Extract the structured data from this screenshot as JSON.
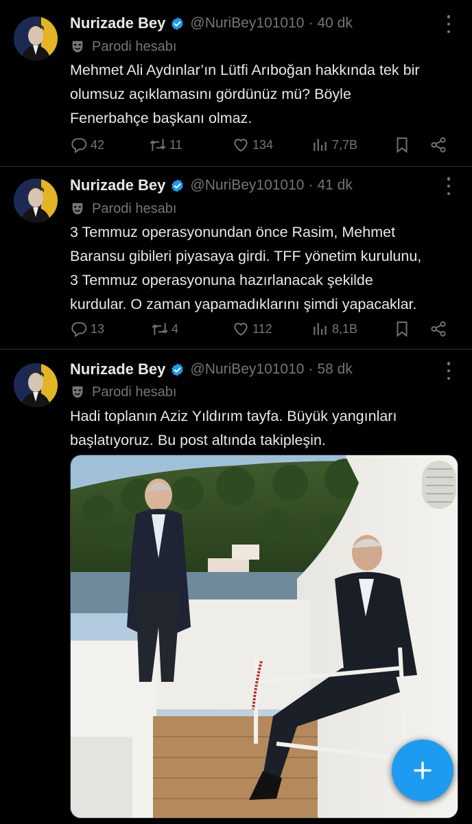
{
  "tweets": [
    {
      "name": "Nurizade Bey",
      "handle": "@NuriBey101010",
      "time": "40 dk",
      "sub": "Parodi hesabı",
      "lines": [
        "Mehmet Ali Aydınlar’ın Lütfi Arıboğan hakkında tek bir",
        "olumsuz açıklamasını gördünüz mü? Böyle",
        "Fenerbahçe başkanı olmaz."
      ],
      "replies": "42",
      "retweets": "11",
      "likes": "134",
      "views": "7,7B"
    },
    {
      "name": "Nurizade Bey",
      "handle": "@NuriBey101010",
      "time": "41 dk",
      "sub": "Parodi hesabı",
      "lines": [
        "3 Temmuz operasyonundan önce Rasim, Mehmet",
        "Baransu gibileri piyasaya girdi. TFF yönetim kurulunu,",
        "3 Temmuz operasyonuna hazırlanacak şekilde",
        "kurdular. O zaman yapamadıklarını şimdi yapacaklar."
      ],
      "replies": "13",
      "retweets": "4",
      "likes": "112",
      "views": "8,1B"
    },
    {
      "name": "Nurizade Bey",
      "handle": "@NuriBey101010",
      "time": "58 dk",
      "sub": "Parodi hesabı",
      "lines": [
        "Hadi toplanın Aziz Yıldırım tayfa. Büyük yangınları",
        "başlatıyoruz. Bu post altında takipleşin."
      ]
    }
  ],
  "icons": {
    "verified": "verified-badge-icon",
    "parody": "parody-mask-icon",
    "reply": "reply-icon",
    "retweet": "retweet-icon",
    "like": "heart-icon",
    "views": "views-icon",
    "bookmark": "bookmark-icon",
    "share": "share-icon",
    "compose": "plus-icon"
  },
  "colors": {
    "background": "#000000",
    "text": "#e7e9ea",
    "muted": "#71767b",
    "accent": "#1d9bf0",
    "divider": "#2f3336"
  }
}
